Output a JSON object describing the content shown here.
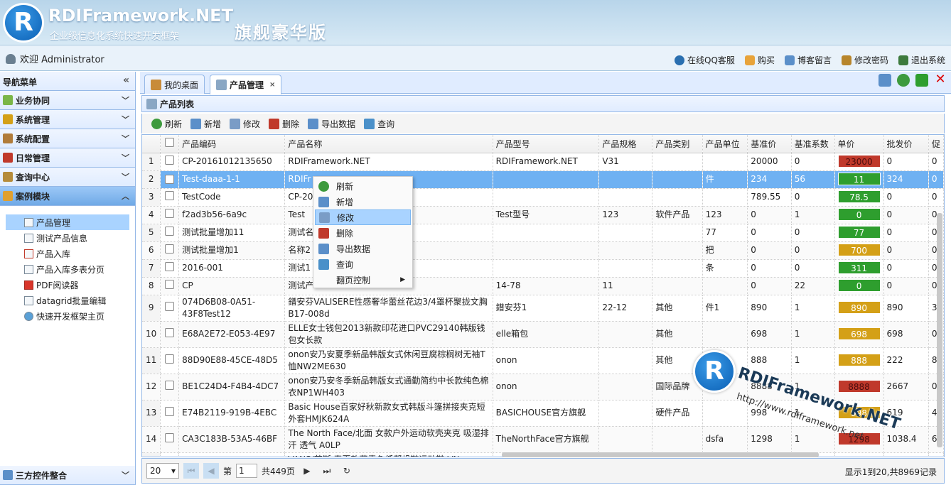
{
  "header": {
    "logo_letter": "R",
    "brand": "RDIFramework.NET",
    "subtitle": "企业级信息化系统快速开发框架",
    "edition": "旗舰豪华版"
  },
  "topbar": {
    "welcome": "欢迎 Administrator",
    "links": [
      "在线QQ客服",
      "购买",
      "博客留言",
      "修改密码",
      "退出系统"
    ]
  },
  "sidebar": {
    "title": "导航菜单",
    "sections": [
      {
        "label": "业务协同",
        "color": "#7ab648"
      },
      {
        "label": "系统管理",
        "color": "#d4a017"
      },
      {
        "label": "系统配置",
        "color": "#b07b3a"
      },
      {
        "label": "日常管理",
        "color": "#c0392b"
      },
      {
        "label": "查询中心",
        "color": "#b58b3a"
      },
      {
        "label": "案例模块",
        "color": "#e0a030"
      }
    ],
    "tree": [
      "产品管理",
      "测试产品信息",
      "产品入库",
      "产品入库多表分页",
      "PDF阅读器",
      "datagrid批量编辑",
      "快速开发框架主页"
    ],
    "footer": "三方控件整合"
  },
  "tabs": [
    {
      "label": "我的桌面"
    },
    {
      "label": "产品管理",
      "close": "×"
    }
  ],
  "panel": {
    "title": "产品列表"
  },
  "toolbar": [
    "刷新",
    "新增",
    "修改",
    "删除",
    "导出数据",
    "查询"
  ],
  "grid": {
    "columns": [
      "产品编码",
      "产品名称",
      "产品型号",
      "产品规格",
      "产品类别",
      "产品单位",
      "基准价",
      "基准系数",
      "单价",
      "批发价",
      "促"
    ],
    "rows": [
      {
        "n": "1",
        "code": "CP-20161012135650",
        "name": "RDIFramework.NET",
        "model": "RDIFramework.NET",
        "spec": "V31",
        "cat": "",
        "unit": "",
        "base": "20000",
        "coef": "0",
        "price": "23000",
        "pcolor": "#c0392b",
        "whole": "0",
        "p": "0"
      },
      {
        "n": "2",
        "code": "Test-daaa-1-1",
        "name": "RDIFr",
        "model": "",
        "spec": "",
        "cat": "",
        "unit": "件",
        "base": "234",
        "coef": "56",
        "price": "11",
        "pcolor": "#2e9e2e",
        "whole": "324",
        "p": "0",
        "sel": true
      },
      {
        "n": "3",
        "code": "TestCode",
        "name": "CP-20",
        "model": "",
        "spec": "",
        "cat": "",
        "unit": "",
        "base": "789.55",
        "coef": "0",
        "price": "78.5",
        "pcolor": "#2e9e2e",
        "whole": "0",
        "p": "0"
      },
      {
        "n": "4",
        "code": "f2ad3b56-6a9c",
        "name": "Test",
        "model": "Test型号",
        "spec": "123",
        "cat": "软件产品",
        "unit": "123",
        "base": "0",
        "coef": "1",
        "price": "0",
        "pcolor": "#2e9e2e",
        "whole": "0",
        "p": "0"
      },
      {
        "n": "5",
        "code": "测试批量增加11",
        "name": "测试名",
        "model": "",
        "spec": "",
        "cat": "",
        "unit": "77",
        "base": "0",
        "coef": "0",
        "price": "77",
        "pcolor": "#2e9e2e",
        "whole": "0",
        "p": "0"
      },
      {
        "n": "6",
        "code": "测试批量增加1",
        "name": "名称2",
        "model": "",
        "spec": "",
        "cat": "",
        "unit": "把",
        "base": "0",
        "coef": "0",
        "price": "700",
        "pcolor": "#d4a017",
        "whole": "0",
        "p": "0"
      },
      {
        "n": "7",
        "code": "2016-001",
        "name": "测试1",
        "model": "",
        "spec": "",
        "cat": "",
        "unit": "条",
        "base": "0",
        "coef": "0",
        "price": "311",
        "pcolor": "#2e9e2e",
        "whole": "0",
        "p": "0"
      },
      {
        "n": "8",
        "code": "CP",
        "name": "测试产",
        "model": "14-78",
        "spec": "11",
        "cat": "",
        "unit": "",
        "base": "0",
        "coef": "22",
        "price": "0",
        "pcolor": "#2e9e2e",
        "whole": "0",
        "p": "0"
      },
      {
        "n": "9",
        "code": "074D6B08-0A51-43F8Test12",
        "name": "鐠安芬VALISERE性感奢华蕾丝花边3/4罩杯聚拢文胸B17-008d",
        "model": "鐠安芬1",
        "spec": "22-12",
        "cat": "其他",
        "unit": "件1",
        "base": "890",
        "coef": "1",
        "price": "890",
        "pcolor": "#d4a017",
        "whole": "890",
        "p": "3"
      },
      {
        "n": "10",
        "code": "E68A2E72-E053-4E97",
        "name": "ELLE女士钱包2013新款印花进口PVC29140韩版钱包女长款",
        "model": "elle箱包",
        "spec": "",
        "cat": "其他",
        "unit": "",
        "base": "698",
        "coef": "1",
        "price": "698",
        "pcolor": "#d4a017",
        "whole": "698",
        "p": "0"
      },
      {
        "n": "11",
        "code": "88D90E88-45CE-48D5",
        "name": "onon安乃安夏季新品韩版女式休闲豆腐棕榈树无袖T恤NW2ME630",
        "model": "onon",
        "spec": "",
        "cat": "其他",
        "unit": "",
        "base": "888",
        "coef": "1",
        "price": "888",
        "pcolor": "#d4a017",
        "whole": "222",
        "p": "8"
      },
      {
        "n": "12",
        "code": "BE1C24D4-F4B4-4DC7",
        "name": "onon安乃安冬季新品韩版女式通勤简约中长款纯色棉衣NP1WH403",
        "model": "onon",
        "spec": "",
        "cat": "国际品牌",
        "unit": "",
        "base": "8888",
        "coef": "1",
        "price": "8888",
        "pcolor": "#c0392b",
        "whole": "2667",
        "p": "0"
      },
      {
        "n": "13",
        "code": "E74B2119-919B-4EBC",
        "name": "Basic House百家好秋新款女式韩版斗篷拼接夹克短外套HMJK624A",
        "model": "BASICHOUSE官方旗舰",
        "spec": "",
        "cat": "硬件产品",
        "unit": "",
        "base": "998",
        "coef": "1",
        "price": "998",
        "pcolor": "#d4a017",
        "whole": "619",
        "p": "4"
      },
      {
        "n": "14",
        "code": "CA3C183B-53A5-46BF",
        "name": "The North Face/北面 女款户外运动软壳夹克 吸湿排汗 透气 A0LP",
        "model": "TheNorthFace官方旗舰",
        "spec": "",
        "cat": "",
        "unit": "dsfa",
        "base": "1298",
        "coef": "1",
        "price": "1298",
        "pcolor": "#c0392b",
        "whole": "1038.4",
        "p": "6"
      },
      {
        "n": "",
        "code": "",
        "name": "VANS/范斯 春夏款藏青色低帮帆鞋运动鞋 VN",
        "model": "",
        "spec": "",
        "cat": "",
        "unit": "",
        "base": "",
        "coef": "",
        "price": "",
        "pcolor": "",
        "whole": "",
        "p": ""
      }
    ]
  },
  "context_menu": [
    "刷新",
    "新增",
    "修改",
    "删除",
    "导出数据",
    "查询",
    "翻页控制"
  ],
  "pager": {
    "page_size": "20",
    "page_label": "第",
    "page": "1",
    "total_pages": "共449页",
    "info": "显示1到20,共8969记录"
  },
  "watermark": {
    "letter": "R",
    "brand": "RDIFramework.NET",
    "url": "http://www.rdiframework.net"
  }
}
